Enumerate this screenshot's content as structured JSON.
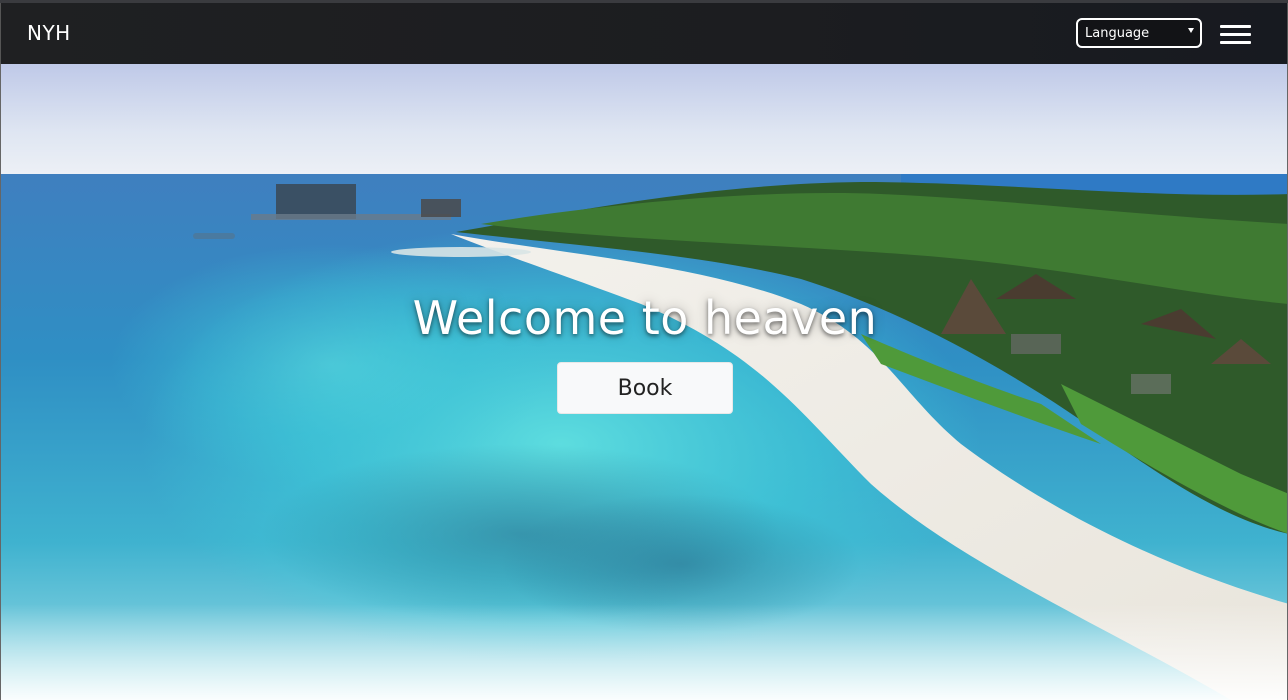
{
  "navbar": {
    "brand": "NYH",
    "language_select": {
      "selected": "Language"
    },
    "menu_icon": "hamburger-menu-icon"
  },
  "hero": {
    "headline": "Welcome to heaven",
    "book_label": "Book",
    "image": "aerial-tropical-beach-resort"
  },
  "colors": {
    "navbar_bg": "#1f2022",
    "button_bg": "#f8f9fa",
    "headline_text": "#ffffff"
  }
}
